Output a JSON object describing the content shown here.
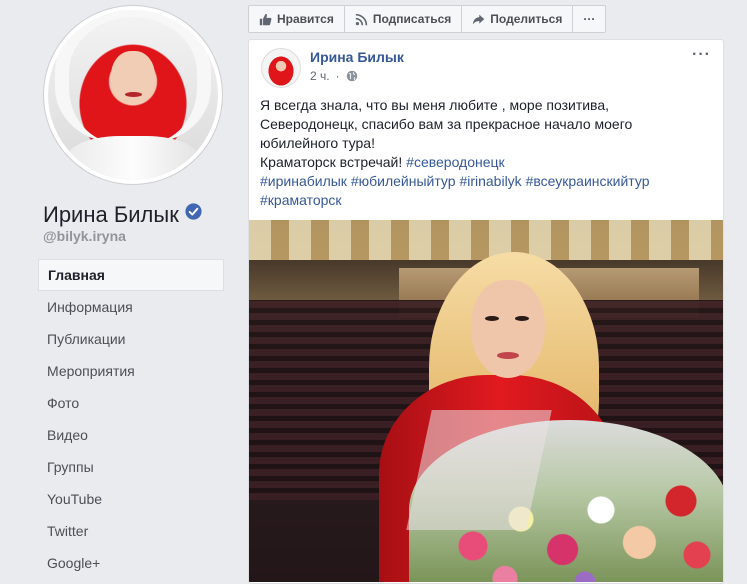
{
  "page": {
    "name": "Ирина Билык",
    "username": "@bilyk.iryna"
  },
  "nav": {
    "items": [
      {
        "label": "Главная",
        "active": true
      },
      {
        "label": "Информация",
        "active": false
      },
      {
        "label": "Публикации",
        "active": false
      },
      {
        "label": "Мероприятия",
        "active": false
      },
      {
        "label": "Фото",
        "active": false
      },
      {
        "label": "Видео",
        "active": false
      },
      {
        "label": "Группы",
        "active": false
      },
      {
        "label": "YouTube",
        "active": false
      },
      {
        "label": "Twitter",
        "active": false
      },
      {
        "label": "Google+",
        "active": false
      }
    ]
  },
  "actions": {
    "like_label": "Нравится",
    "follow_label": "Подписаться",
    "share_label": "Поделиться",
    "more_label": "···"
  },
  "post": {
    "author": "Ирина Билык",
    "time": "2 ч.",
    "menu_label": "···",
    "text_lines": [
      "Я всегда знала, что вы меня любите , море позитива,",
      "Северодонецк, спасибо вам за прекрасное начало моего",
      "юбилейного тура!"
    ],
    "line4_text": "Краматорск встречай! ",
    "line4_tag": "#северодонецк",
    "hashtags_line5": [
      "#иринабилык",
      "#юбилейныйтур",
      "#irinabilyk",
      "#всеукраинскийтур"
    ],
    "hashtag_line6": "#краматорск"
  },
  "colors": {
    "link": "#365899",
    "verified": "#4267b2",
    "background": "#e9ebee"
  },
  "icons": {
    "verified": "verified-badge-icon",
    "like": "thumbs-up-icon",
    "follow": "rss-icon",
    "share": "share-arrow-icon",
    "privacy": "globe-icon"
  }
}
